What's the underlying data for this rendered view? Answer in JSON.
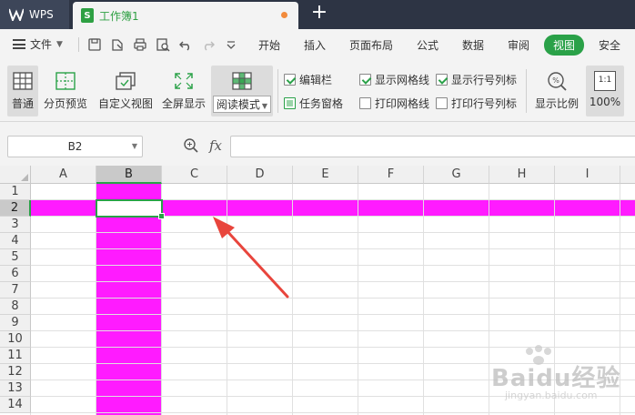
{
  "app": {
    "wps_label": "WPS"
  },
  "document_tab": {
    "title": "工作簿1",
    "icon_letter": "S"
  },
  "menu": {
    "file": "文件",
    "items": [
      "开始",
      "插入",
      "页面布局",
      "公式",
      "数据",
      "审阅",
      "视图",
      "安全"
    ],
    "active": "视图"
  },
  "ribbon": {
    "buttons": {
      "normal": "普通",
      "page_break": "分页预览",
      "custom_view": "自定义视图",
      "full_screen": "全屏显示",
      "reading_mode": "阅读模式",
      "zoom": "显示比例",
      "zoom_100": "100%",
      "zoom_100_icon": "1:1"
    },
    "checks": {
      "edit_bar": "编辑栏",
      "task_pane": "任务窗格",
      "show_gridlines": "显示网格线",
      "print_gridlines": "打印网格线",
      "show_headings": "显示行号列标",
      "print_headings": "打印行号列标"
    },
    "check_states": {
      "edit_bar": true,
      "show_gridlines": true,
      "show_headings": true,
      "print_gridlines": false,
      "print_headings": false
    }
  },
  "formula_bar": {
    "cell_reference": "B2",
    "fx_label": "fx",
    "value": ""
  },
  "sheet": {
    "columns": [
      "A",
      "B",
      "C",
      "D",
      "E",
      "F",
      "G",
      "H",
      "I"
    ],
    "rows": [
      "1",
      "2",
      "3",
      "4",
      "5",
      "6",
      "7",
      "8",
      "9",
      "10",
      "11",
      "12",
      "13",
      "14"
    ],
    "selected_column": "B",
    "selected_row": "2",
    "highlight_color": "#ff1bff",
    "accent_color": "#2aa148"
  },
  "watermark": {
    "brand": "Baidu经验",
    "url": "jingyan.baidu.com"
  }
}
